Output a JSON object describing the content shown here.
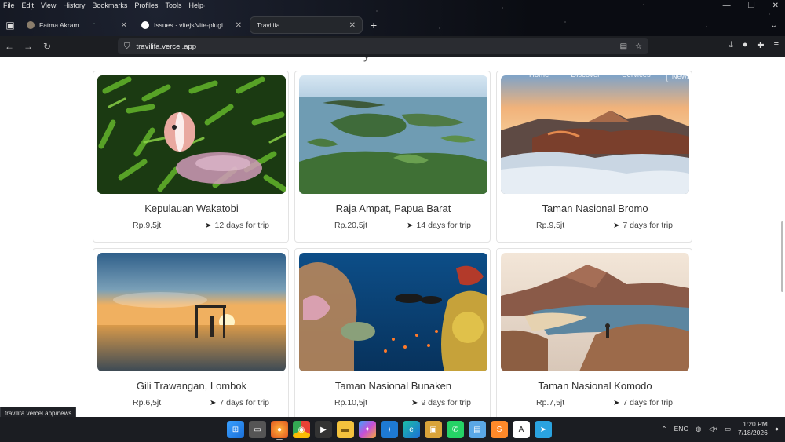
{
  "menu": [
    "File",
    "Edit",
    "View",
    "History",
    "Bookmarks",
    "Profiles",
    "Tools",
    "Help"
  ],
  "tabs": [
    {
      "title": "Fatma Akram",
      "active": false,
      "icon": "profile-icon",
      "color": "#8a7d6b"
    },
    {
      "title": "Issues · vitejs/vite-plugin-react",
      "active": false,
      "icon": "github-icon",
      "color": "#ffffff"
    },
    {
      "title": "Travilifa",
      "active": true,
      "icon": "site-icon",
      "color": "#24272c"
    }
  ],
  "url": "travilifa.vercel.app",
  "site_nav": [
    "Home",
    "Discover",
    "Services",
    "News"
  ],
  "destinations": [
    {
      "name": "Kepulauan Wakatobi",
      "price": "Rp.9,5jt",
      "trip": "12 days for trip",
      "scene": "clownfish"
    },
    {
      "name": "Raja Ampat, Papua Barat",
      "price": "Rp.20,5jt",
      "trip": "14 days for trip",
      "scene": "islands"
    },
    {
      "name": "Taman Nasional Bromo",
      "price": "Rp.9,5jt",
      "trip": "7 days for trip",
      "scene": "volcano"
    },
    {
      "name": "Gili Trawangan, Lombok",
      "price": "Rp.6,5jt",
      "trip": "7 days for trip",
      "scene": "sunset"
    },
    {
      "name": "Taman Nasional Bunaken",
      "price": "Rp.10,5jt",
      "trip": "9 days for trip",
      "scene": "reef"
    },
    {
      "name": "Taman Nasional Komodo",
      "price": "Rp.7,5jt",
      "trip": "7 days for trip",
      "scene": "komodo"
    }
  ],
  "status_link": "travilifa.vercel.app/news",
  "taskbar": {
    "apps": [
      "windows-start",
      "task-view",
      "firefox",
      "chrome",
      "media-player",
      "file-explorer",
      "copilot",
      "vscode",
      "edge",
      "app-tool",
      "whatsapp",
      "notepad",
      "sublime",
      "app-a",
      "telegram"
    ],
    "lang": "ENG",
    "time": "1:20 PM",
    "date": "7/18/2026"
  }
}
